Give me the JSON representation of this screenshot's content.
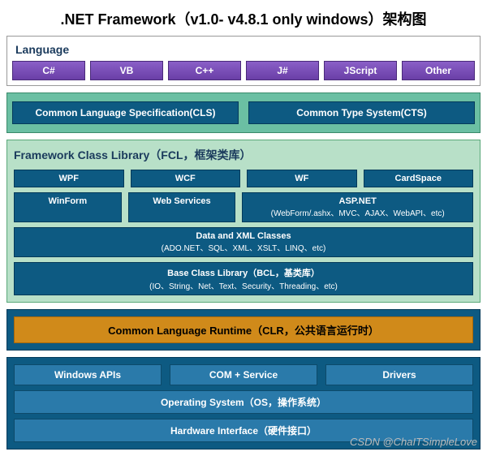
{
  "title": ".NET Framework（v1.0- v4.8.1 only windows）架构图",
  "language": {
    "label": "Language",
    "items": [
      "C#",
      "VB",
      "C++",
      "J#",
      "JScript",
      "Other"
    ]
  },
  "cls": {
    "left": "Common Language Specification(CLS)",
    "right": "Common Type System(CTS)"
  },
  "fcl": {
    "title": "Framework Class Library（FCL，框架类库）",
    "row1": [
      "WPF",
      "WCF",
      "WF",
      "CardSpace"
    ],
    "row2": {
      "items": [
        "WinForm",
        "Web Services"
      ],
      "asp": {
        "title": "ASP.NET",
        "sub": "(WebForm/.ashx、MVC、AJAX、WebAPI、etc)"
      }
    },
    "dataxml": {
      "title": "Data and XML Classes",
      "sub": "(ADO.NET、SQL、XML、XSLT、LINQ、etc)"
    },
    "bcl": {
      "title": "Base Class Library（BCL，基类库）",
      "sub": "(IO、String、Net、Text、Security、Threading、etc)"
    }
  },
  "clr": "Common Language Runtime（CLR，公共语言运行时）",
  "system": {
    "row1": [
      "Windows APIs",
      "COM + Service",
      "Drivers"
    ],
    "os": "Operating System（OS，操作系统）",
    "hw": "Hardware Interface（硬件接口）"
  },
  "watermark": "CSDN @ChaITSimpleLove"
}
